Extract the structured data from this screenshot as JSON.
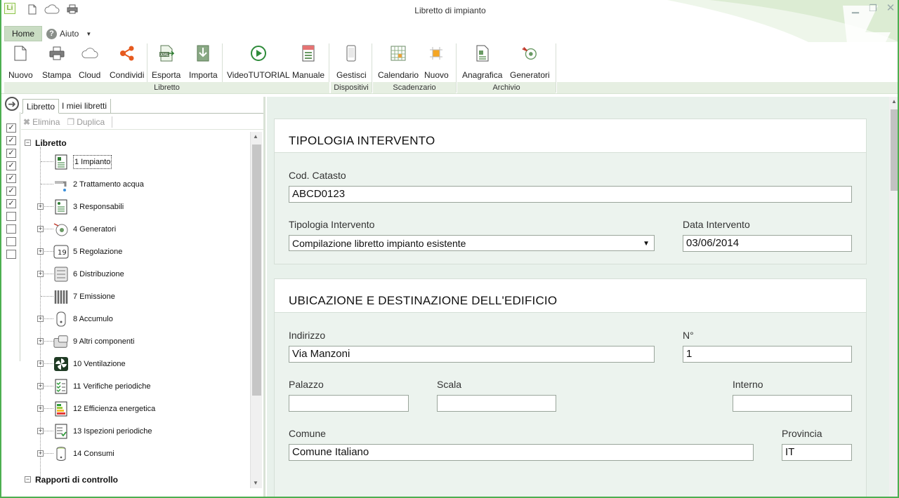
{
  "window": {
    "title": "Libretto di impianto",
    "app_logo": "Li",
    "quick_access_icons": [
      "new-document-icon",
      "cloud-icon",
      "print-icon"
    ],
    "controls": {
      "minimize": "minimize-icon",
      "restore": "restore-icon",
      "close": "close-icon"
    }
  },
  "menu": {
    "tabs": [
      {
        "label": "Home",
        "active": true
      },
      {
        "label": "Aiuto",
        "active": false
      }
    ]
  },
  "ribbon": {
    "buttons": [
      {
        "label": "Nuovo",
        "icon": "new-document-icon"
      },
      {
        "label": "Stampa",
        "icon": "print-icon"
      },
      {
        "label": "Cloud",
        "icon": "cloud-icon"
      },
      {
        "label": "Condividi",
        "icon": "share-icon"
      },
      {
        "label": "Esporta",
        "icon": "export-xml-icon"
      },
      {
        "label": "Importa",
        "icon": "import-icon"
      },
      {
        "label": "VideoTUTORIAL",
        "icon": "play-icon"
      },
      {
        "label": "Manuale",
        "icon": "manual-icon"
      },
      {
        "label": "Gestisci",
        "icon": "phone-icon"
      },
      {
        "label": "Calendario",
        "icon": "calendar-icon"
      },
      {
        "label": "Nuovo",
        "icon": "new-deadline-icon"
      },
      {
        "label": "Anagrafica",
        "icon": "registry-icon"
      },
      {
        "label": "Generatori",
        "icon": "generators-icon"
      }
    ],
    "groups": [
      "Libretto",
      "Dispositivi",
      "Scadenzario",
      "Archivio"
    ]
  },
  "left_panel": {
    "tabs": [
      {
        "label": "Libretto",
        "active": true
      },
      {
        "label": "I miei libretti",
        "active": false
      }
    ],
    "toolbar": {
      "delete": "Elimina",
      "duplicate": "Duplica"
    },
    "checkboxes": [
      true,
      true,
      true,
      true,
      true,
      true,
      true,
      false,
      false,
      false,
      false
    ],
    "tree": {
      "root": "Libretto",
      "items": [
        {
          "label": "1 Impianto",
          "icon": "plant-doc-icon",
          "expandable": false,
          "selected": true
        },
        {
          "label": "2 Trattamento acqua",
          "icon": "water-tap-icon",
          "expandable": false
        },
        {
          "label": "3 Responsabili",
          "icon": "responsible-doc-icon",
          "expandable": true
        },
        {
          "label": "4 Generatori",
          "icon": "generator-icon",
          "expandable": true
        },
        {
          "label": "5 Regolazione",
          "icon": "thermostat-icon",
          "expandable": true
        },
        {
          "label": "6 Distribuzione",
          "icon": "distribution-icon",
          "expandable": true
        },
        {
          "label": "7 Emissione",
          "icon": "radiator-icon",
          "expandable": false
        },
        {
          "label": "8 Accumulo",
          "icon": "tank-icon",
          "expandable": true
        },
        {
          "label": "9 Altri componenti",
          "icon": "components-icon",
          "expandable": true
        },
        {
          "label": "10 Ventilazione",
          "icon": "fan-icon",
          "expandable": true
        },
        {
          "label": "11 Verifiche periodiche",
          "icon": "checklist-icon",
          "expandable": true
        },
        {
          "label": "12 Efficienza energetica",
          "icon": "energy-icon",
          "expandable": true
        },
        {
          "label": "13 Ispezioni periodiche",
          "icon": "inspection-icon",
          "expandable": true
        },
        {
          "label": "14 Consumi",
          "icon": "consumption-icon",
          "expandable": true
        }
      ],
      "second_root": "Rapporti di controllo"
    }
  },
  "form": {
    "section1": {
      "title": "TIPOLOGIA INTERVENTO",
      "cod_catasto": {
        "label": "Cod. Catasto",
        "value": "ABCD0123"
      },
      "tipologia": {
        "label": "Tipologia Intervento",
        "value": "Compilazione libretto impianto esistente",
        "arrow": "▼"
      },
      "data": {
        "label": "Data Intervento",
        "value": "03/06/2014"
      }
    },
    "section2": {
      "title": "UBICAZIONE E DESTINAZIONE DELL'EDIFICIO",
      "indirizzo": {
        "label": "Indirizzo",
        "value": "Via Manzoni"
      },
      "numero": {
        "label": "N°",
        "value": "1"
      },
      "palazzo": {
        "label": "Palazzo",
        "value": ""
      },
      "scala": {
        "label": "Scala",
        "value": ""
      },
      "interno": {
        "label": "Interno",
        "value": ""
      },
      "comune": {
        "label": "Comune",
        "value": "Comune Italiano"
      },
      "provincia": {
        "label": "Provincia",
        "value": "IT"
      }
    }
  }
}
